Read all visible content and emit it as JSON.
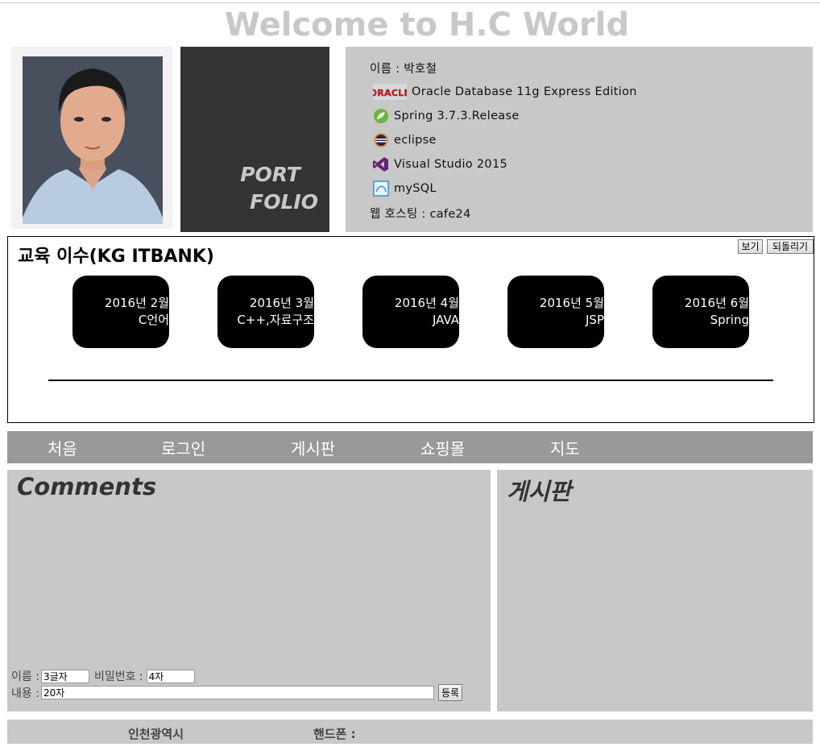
{
  "site": {
    "title": "Welcome to H.C World"
  },
  "portfolio": {
    "line1": "PORT",
    "line2": "FOLIO"
  },
  "profile": {
    "name": "이름 : 박호철",
    "tools": [
      {
        "icon": "oracle-logo-icon",
        "label": "Oracle Database 11g Express Edition"
      },
      {
        "icon": "spring-leaf-icon",
        "label": "Spring 3.7.3.Release"
      },
      {
        "icon": "eclipse-icon",
        "label": "eclipse"
      },
      {
        "icon": "visual-studio-icon",
        "label": "Visual Studio 2015"
      },
      {
        "icon": "mysql-icon",
        "label": "mySQL"
      }
    ],
    "hosting": "웹 호스팅 : cafe24",
    "oracle_logo_text": "ORACLE"
  },
  "education": {
    "title": "교육 이수(KG ITBANK)",
    "view_button": "보기",
    "revert_button": "되돌리기",
    "courses": [
      {
        "date": "2016년 2월",
        "subject": "C언어"
      },
      {
        "date": "2016년 3월",
        "subject": "C++,자료구조"
      },
      {
        "date": "2016년 4월",
        "subject": "JAVA"
      },
      {
        "date": "2016년 5월",
        "subject": "JSP"
      },
      {
        "date": "2016년 6월",
        "subject": "Spring"
      }
    ]
  },
  "nav": {
    "items": [
      "처음",
      "로그인",
      "게시판",
      "쇼핑몰",
      "지도"
    ]
  },
  "comments": {
    "title": "Comments",
    "name_label": "이름 :",
    "name_value": "3글자",
    "password_label": "비밀번호 :",
    "password_value": "4자",
    "content_label": "내용 :",
    "content_value": "20자",
    "submit_label": "등록"
  },
  "board": {
    "title": "게시판"
  },
  "footer": {
    "city": "인천광역시",
    "phone_label": "핸드폰 :"
  },
  "colors": {
    "panel_gray": "#c8c8c8",
    "dark_box": "#333333",
    "nav_gray": "#999999",
    "course_black": "#000000"
  }
}
